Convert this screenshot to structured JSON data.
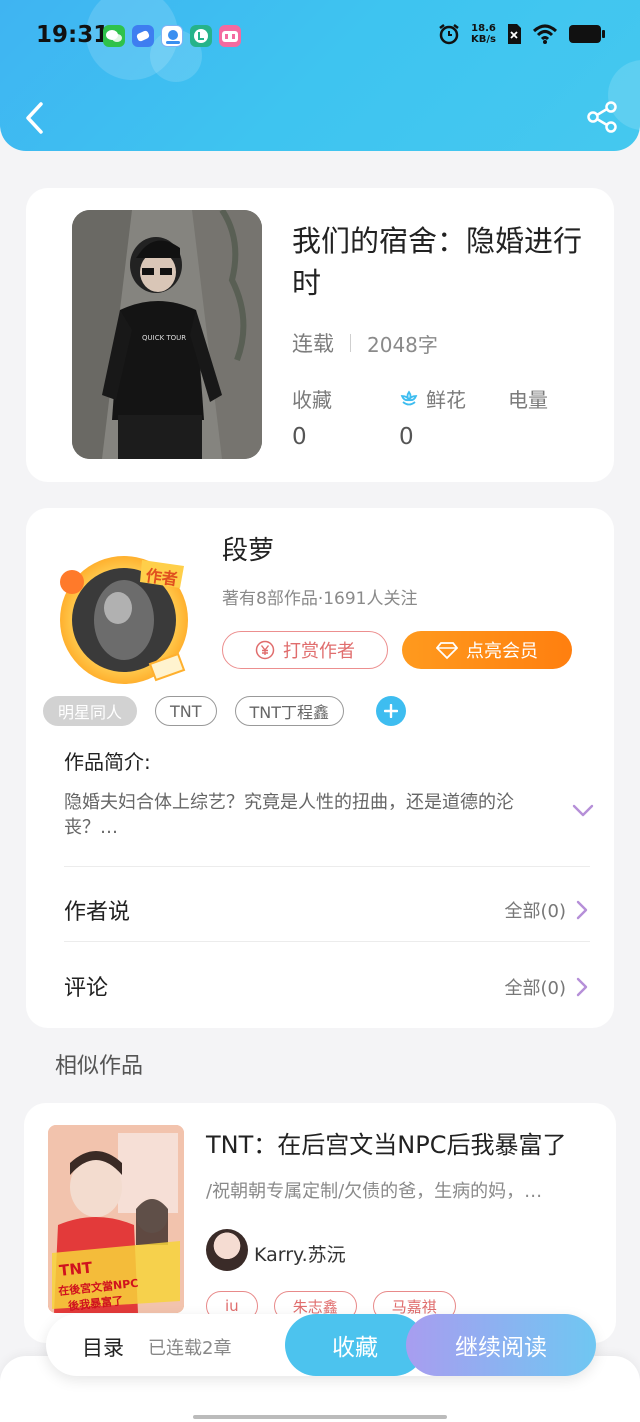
{
  "status_bar": {
    "time": "19:31",
    "net_speed_value": "18.6",
    "net_speed_unit": "KB/s",
    "icons": [
      "wechat-icon",
      "note-icon",
      "baby-icon",
      "line-icon",
      "bilibili-icon",
      "alarm-icon",
      "sim-off-icon",
      "wifi-icon",
      "battery-icon"
    ]
  },
  "header": {
    "back_icon": "chevron-left-icon",
    "share_icon": "share-icon"
  },
  "book": {
    "title": "我们的宿舍：隐婚进行时",
    "status": "连载",
    "word_count": "2048字",
    "stats": [
      {
        "label": "收藏",
        "value": "0"
      },
      {
        "label": "鲜花",
        "value": "0",
        "icon": "flower-icon"
      },
      {
        "label": "电量",
        "value": ""
      }
    ]
  },
  "author": {
    "name": "段萝",
    "badge": "作者",
    "stats": "著有8部作品·1691人关注",
    "tip_button": "打赏作者",
    "vip_button": "点亮会员"
  },
  "tags": [
    "明星同人",
    "TNT",
    "TNT丁程鑫"
  ],
  "intro": {
    "label": "作品简介:",
    "text": "隐婚夫妇合体上综艺？究竟是人性的扭曲，还是道德的沦丧？…"
  },
  "rows": [
    {
      "label": "作者说",
      "value": "全部(0)"
    },
    {
      "label": "评论",
      "value": "全部(0)"
    }
  ],
  "similar": {
    "section_title": "相似作品",
    "items": [
      {
        "title": "TNT：在后宫文当NPC后我暴富了",
        "desc": "/祝朝朝专属定制/欠债的爸，生病的妈，…",
        "author": "Karry.苏沅",
        "cover_text": "TNT 在後宮文當NPC 後我暴富了",
        "tags": [
          "iu",
          "朱志鑫",
          "马嘉祺"
        ]
      }
    ]
  },
  "bottom": {
    "toc_label": "目录",
    "toc_count": "已连载2章",
    "collect_button": "收藏",
    "read_button": "继续阅读"
  },
  "colors": {
    "header_blue": "#3fb4f2",
    "accent_blue": "#3ebdf0",
    "vip_orange": "#ff8c16",
    "tip_red": "#e06d6d",
    "read_purple": "#a89df0"
  }
}
